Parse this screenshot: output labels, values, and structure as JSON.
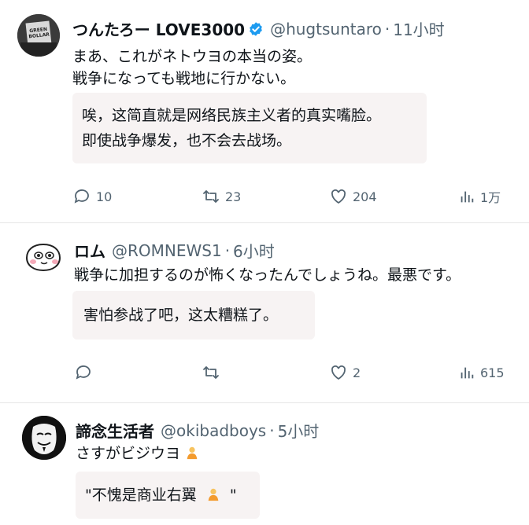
{
  "tweets": [
    {
      "name": "つんたろー LOVE3000",
      "handle": "@hugtsuntaro",
      "dot": "·",
      "time": "11小时",
      "avatar_text": "GREEN BOLLAR",
      "text_lines": [
        "まあ、これがネトウヨの本当の姿。",
        "戦争になっても戦地に行かない。"
      ],
      "translation_lines": [
        "唉，这简直就是网络民族主义者的真实嘴脸。",
        "即使战争爆发，也不会去战场。"
      ],
      "actions": {
        "reply": "10",
        "retweet": "23",
        "like": "204",
        "views": "1万"
      }
    },
    {
      "name": "ロム",
      "handle": "@ROMNEWS1",
      "dot": "·",
      "time": "6小时",
      "text_lines": [
        "戦争に加担するのが怖くなったんでしょうね。最悪です。"
      ],
      "translation_lines": [
        "害怕参战了吧，这太糟糕了。"
      ],
      "actions": {
        "reply": "",
        "retweet": "",
        "like": "2",
        "views": "615"
      }
    },
    {
      "name": "諦念生活者",
      "handle": "@okibadboys",
      "dot": "·",
      "time": "5小时",
      "text_lines": [
        "さすがビジウヨ"
      ],
      "translation_lines": [
        "\"不愧是商业右翼",
        "\""
      ]
    }
  ],
  "colors": {
    "verified": "#1d9bf0",
    "muted": "#536471",
    "translation_bg": "#f7f3f3"
  }
}
